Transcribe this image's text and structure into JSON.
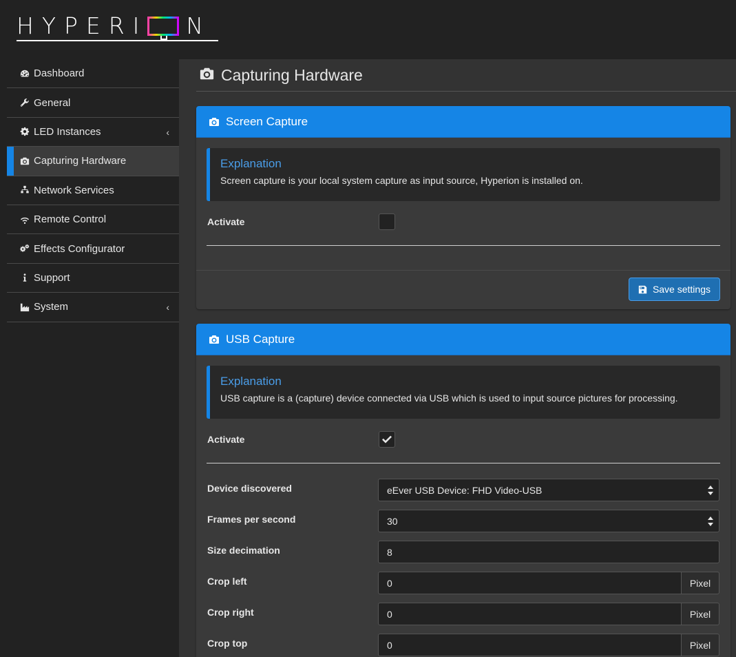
{
  "logo": {
    "text_left": "HYPERI",
    "text_right": "N"
  },
  "sidebar": {
    "items": [
      {
        "label": "Dashboard",
        "icon": "dashboard-icon"
      },
      {
        "label": "General",
        "icon": "wrench-icon"
      },
      {
        "label": "LED Instances",
        "icon": "gear-icon",
        "caret": "‹"
      },
      {
        "label": "Capturing Hardware",
        "icon": "camera-icon",
        "active": true
      },
      {
        "label": "Network Services",
        "icon": "sitemap-icon"
      },
      {
        "label": "Remote Control",
        "icon": "wifi-icon"
      },
      {
        "label": "Effects Configurator",
        "icon": "cogs-icon"
      },
      {
        "label": "Support",
        "icon": "info-icon"
      },
      {
        "label": "System",
        "icon": "industry-icon",
        "caret": "‹"
      }
    ]
  },
  "page": {
    "title": "Capturing Hardware"
  },
  "screen_capture": {
    "heading": "Screen Capture",
    "explanation_title": "Explanation",
    "explanation_text": "Screen capture is your local system capture as input source, Hyperion is installed on.",
    "activate_label": "Activate",
    "activate_checked": false,
    "save_label": "Save settings"
  },
  "usb_capture": {
    "heading": "USB Capture",
    "explanation_title": "Explanation",
    "explanation_text": "USB capture is a (capture) device connected via USB which is used to input source pictures for processing.",
    "activate_label": "Activate",
    "activate_checked": true,
    "fields": {
      "device_label": "Device discovered",
      "device_value": "eEver USB Device: FHD Video-USB",
      "fps_label": "Frames per second",
      "fps_value": "30",
      "decimation_label": "Size decimation",
      "decimation_value": "8",
      "crop_left_label": "Crop left",
      "crop_left_value": "0",
      "crop_right_label": "Crop right",
      "crop_right_value": "0",
      "crop_top_label": "Crop top",
      "crop_top_value": "0",
      "unit": "Pixel"
    }
  },
  "colors": {
    "accent": "#1585e6",
    "background": "#222222",
    "panel": "#3a3a3a"
  }
}
